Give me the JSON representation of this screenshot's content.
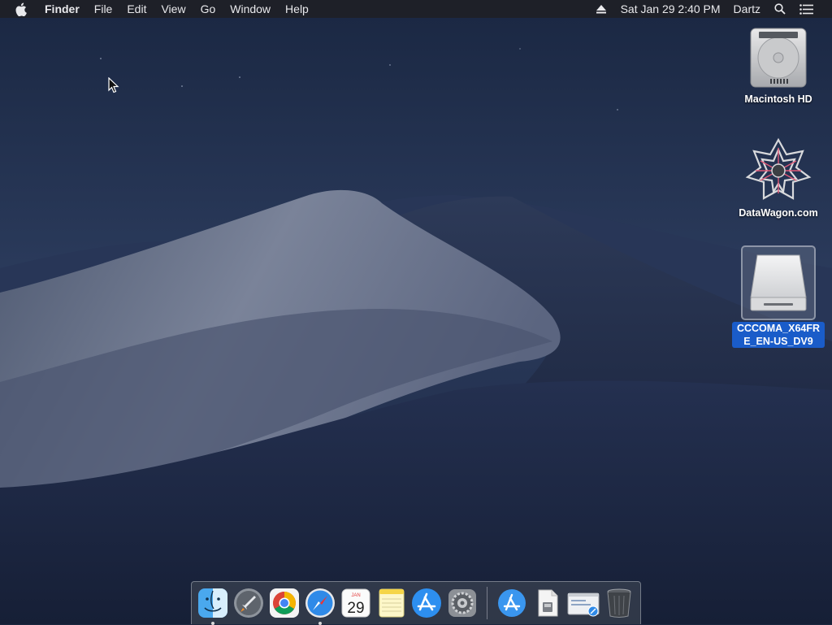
{
  "menubar": {
    "apple_icon": "apple-icon",
    "app_name": "Finder",
    "menus": [
      "File",
      "Edit",
      "View",
      "Go",
      "Window",
      "Help"
    ],
    "eject_icon": "eject-icon",
    "datetime": "Sat Jan 29  2:40 PM",
    "user": "Dartz",
    "spotlight_icon": "search-icon",
    "notification_icon": "list-icon"
  },
  "desktop": {
    "icons": [
      {
        "label": "Macintosh HD",
        "icon": "hard-drive-icon"
      },
      {
        "label": "DataWagon.com",
        "icon": "datawagon-icon"
      },
      {
        "label": "CCCOMA_X64FRE_EN-US_DV9",
        "icon": "external-drive-icon",
        "selected": true
      }
    ]
  },
  "dock": {
    "apps": [
      {
        "name": "Finder",
        "icon": "finder-icon",
        "running": true
      },
      {
        "name": "Launchpad",
        "icon": "launchpad-icon",
        "running": false
      },
      {
        "name": "Google Chrome",
        "icon": "chrome-icon",
        "running": false
      },
      {
        "name": "Safari",
        "icon": "safari-icon",
        "running": true
      },
      {
        "name": "Calendar",
        "icon": "calendar-icon",
        "running": false,
        "month": "JAN",
        "day": "29"
      },
      {
        "name": "Notes",
        "icon": "notes-icon",
        "running": false
      },
      {
        "name": "App Store",
        "icon": "app-store-icon",
        "running": false
      },
      {
        "name": "System Preferences",
        "icon": "gear-icon",
        "running": false
      }
    ],
    "others": [
      {
        "name": "Applications",
        "icon": "applications-folder-icon"
      },
      {
        "name": "Document",
        "icon": "document-icon"
      },
      {
        "name": "Screenshot",
        "icon": "screenshot-icon"
      },
      {
        "name": "Trash",
        "icon": "trash-icon"
      }
    ]
  },
  "colors": {
    "menubar_bg": "#1e2026",
    "selection": "#1a5cc9",
    "sky_top": "#1b2a47",
    "dune": "#5a6680"
  }
}
